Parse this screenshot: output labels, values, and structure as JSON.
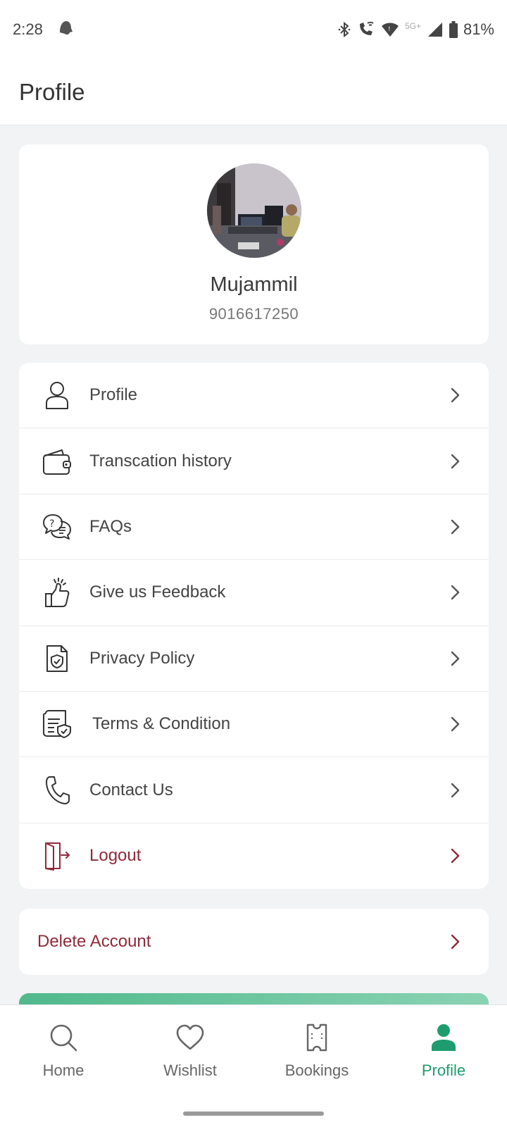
{
  "status_bar": {
    "time": "2:28",
    "network": "5G+",
    "battery": "81%"
  },
  "header": {
    "title": "Profile"
  },
  "profile": {
    "name": "Mujammil",
    "phone": "9016617250"
  },
  "menu": {
    "items": [
      {
        "label": "Profile",
        "icon": "user-icon"
      },
      {
        "label": "Transcation history",
        "icon": "wallet-icon"
      },
      {
        "label": "FAQs",
        "icon": "faq-chat-icon"
      },
      {
        "label": "Give us Feedback",
        "icon": "thumbs-up-icon"
      },
      {
        "label": "Privacy Policy",
        "icon": "shield-document-icon"
      },
      {
        "label": "Terms & Condition",
        "icon": "terms-document-icon"
      },
      {
        "label": "Contact Us",
        "icon": "phone-icon"
      },
      {
        "label": "Logout",
        "icon": "logout-door-icon"
      }
    ]
  },
  "delete_account": {
    "label": "Delete Account"
  },
  "bottom_nav": {
    "items": [
      {
        "label": "Home",
        "icon": "search-icon",
        "active": false
      },
      {
        "label": "Wishlist",
        "icon": "heart-icon",
        "active": false
      },
      {
        "label": "Bookings",
        "icon": "ticket-icon",
        "active": false
      },
      {
        "label": "Profile",
        "icon": "person-icon",
        "active": true
      }
    ]
  },
  "colors": {
    "accent_green": "#1f9c6e",
    "danger": "#8f2a3a",
    "text": "#444444"
  }
}
